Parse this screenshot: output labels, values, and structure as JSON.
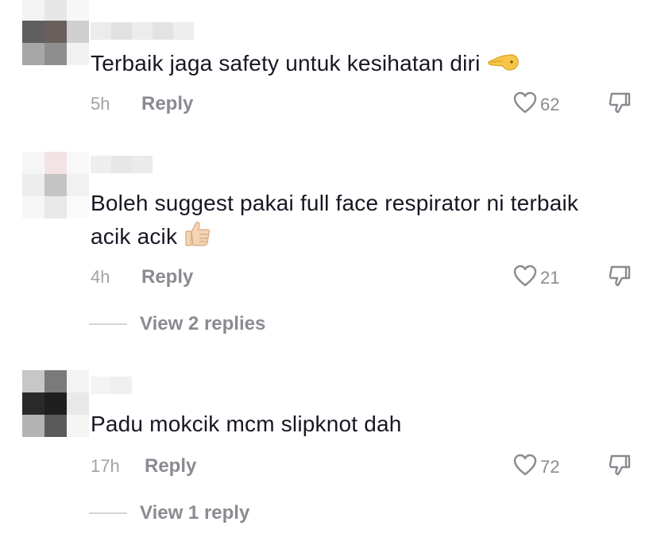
{
  "comments": [
    {
      "text": "Terbaik jaga safety untuk kesihatan diri",
      "emoji_icon": "point-left-hand-emoji",
      "time": "5h",
      "reply_label": "Reply",
      "likes": "62"
    },
    {
      "text_line1": "Boleh suggest pakai full face respirator ni terbaik",
      "text_line2": "acik acik",
      "emoji_icon": "thumbs-up-emoji",
      "time": "4h",
      "reply_label": "Reply",
      "likes": "21",
      "view_replies": "View 2 replies"
    },
    {
      "text": "Padu mokcik mcm slipknot dah",
      "time": "17h",
      "reply_label": "Reply",
      "likes": "72",
      "view_replies": "View 1 reply"
    }
  ],
  "icons": {
    "like": "heart-outline-icon",
    "dislike": "thumbs-down-outline-icon"
  },
  "colors": {
    "text": "#161823",
    "secondary": "#8a8b91",
    "time": "#a1a2a7"
  }
}
